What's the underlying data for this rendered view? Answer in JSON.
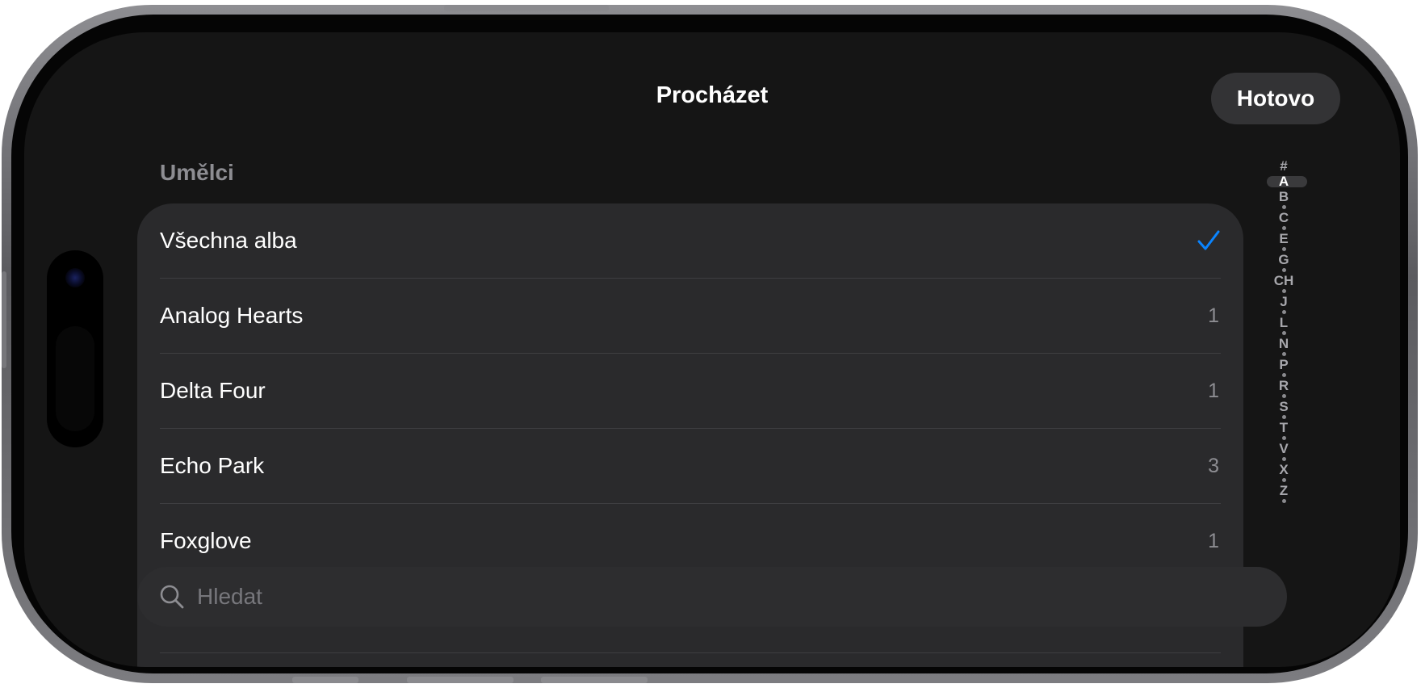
{
  "header": {
    "title": "Procházet",
    "done_label": "Hotovo"
  },
  "section": {
    "title": "Umělci"
  },
  "list": {
    "items": [
      {
        "label": "Všechna alba",
        "selected": true
      },
      {
        "label": "Analog Hearts",
        "count": "1"
      },
      {
        "label": "Delta Four",
        "count": "1"
      },
      {
        "label": "Echo Park",
        "count": "3"
      },
      {
        "label": "Foxglove",
        "count": "1"
      }
    ]
  },
  "search": {
    "placeholder": "Hledat",
    "value": "",
    "icon": "magnifier-icon"
  },
  "index": {
    "letters": [
      "#",
      "A",
      "B",
      "C",
      "E",
      "G",
      "CH",
      "J",
      "L",
      "N",
      "P",
      "R",
      "S",
      "T",
      "V",
      "X",
      "Z"
    ],
    "active": "A"
  },
  "colors": {
    "accent": "#0a84ff",
    "background": "#151515",
    "card": "#2a2a2c",
    "secondary_text": "#8d8d92"
  }
}
